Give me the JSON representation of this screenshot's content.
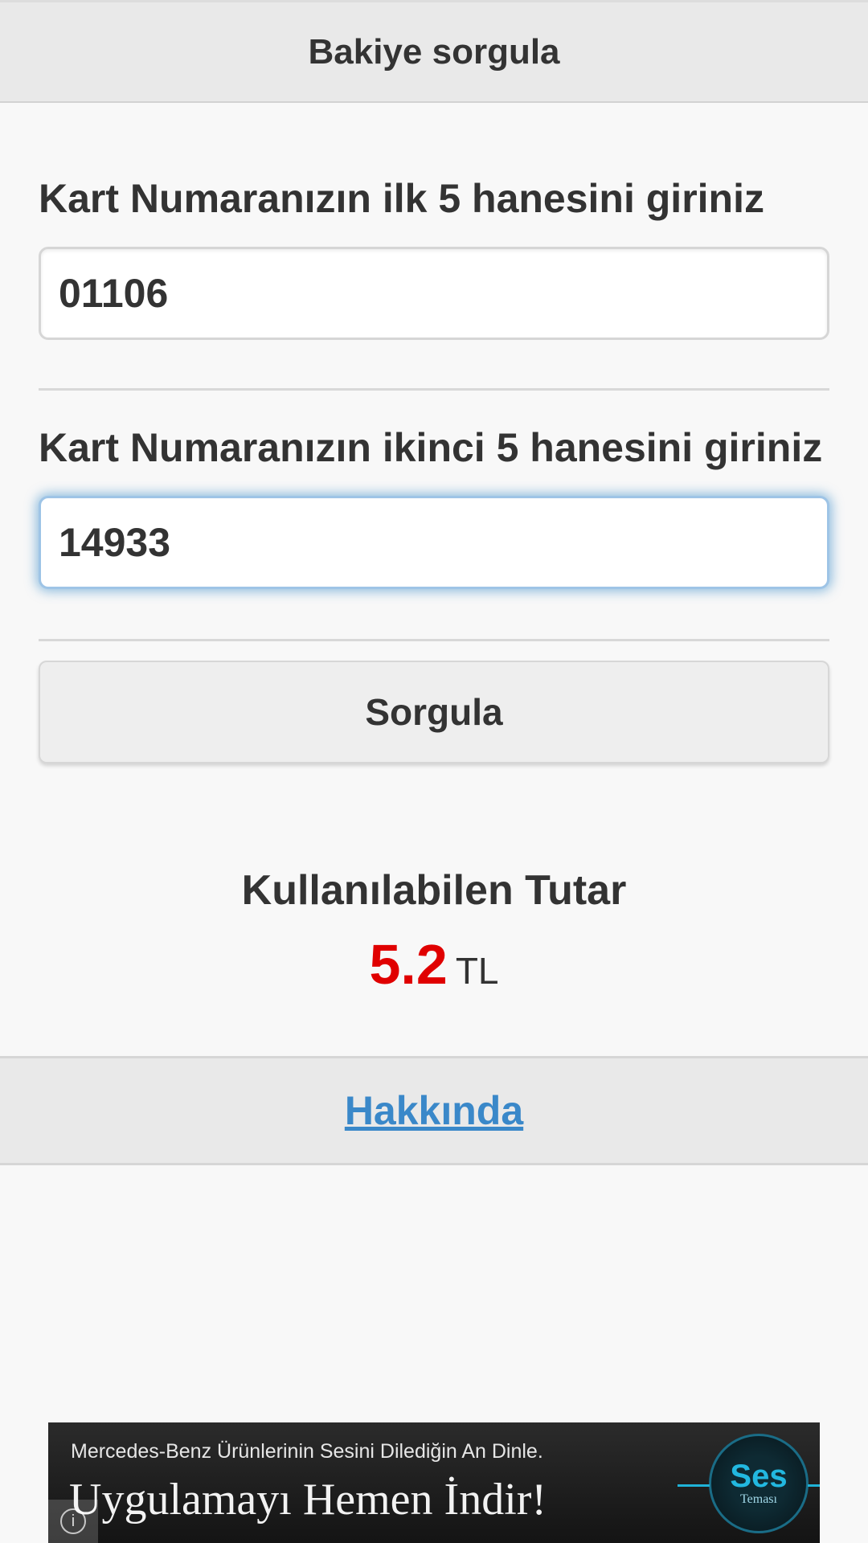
{
  "header": {
    "title": "Bakiye sorgula"
  },
  "form": {
    "first_label": "Kart Numaranızın ilk 5 hanesini giriniz",
    "first_value": "01106",
    "second_label": "Kart Numaranızın ikinci 5 hanesini giriniz",
    "second_value": "14933",
    "submit_label": "Sorgula"
  },
  "result": {
    "label": "Kullanılabilen Tutar",
    "amount": "5.2",
    "currency": "TL",
    "amount_color": "#e00000"
  },
  "footer": {
    "about_link": "Hakkında",
    "link_color": "#3a88c9"
  },
  "ad": {
    "line1": "Mercedes-Benz Ürünlerinin Sesini Dilediğin An Dinle.",
    "line2": "Uygulamayı Hemen İndir!",
    "logo_title": "Ses",
    "logo_subtitle": "Teması",
    "info_icon": "info-icon"
  }
}
